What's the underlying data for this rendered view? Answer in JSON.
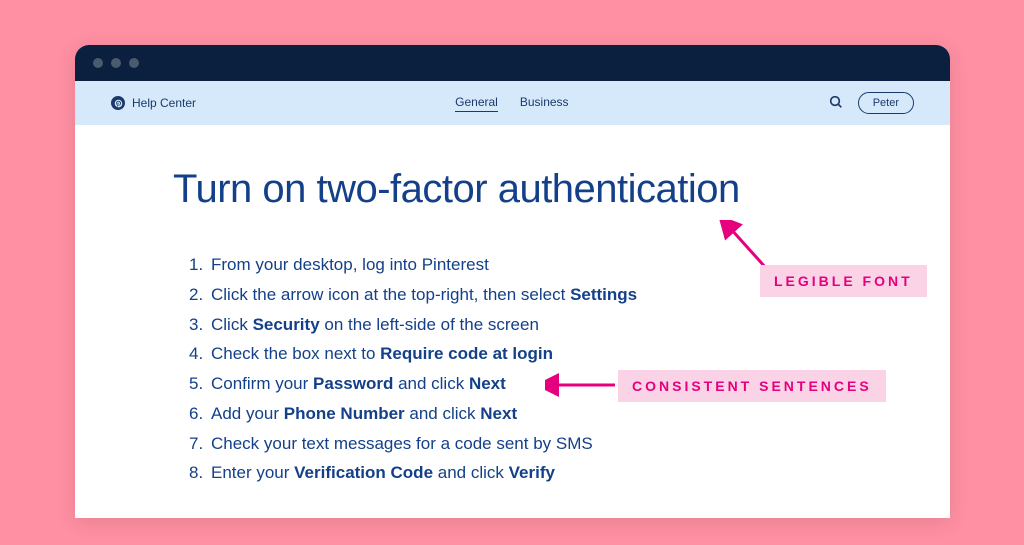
{
  "brand": {
    "help_center_label": "Help Center"
  },
  "nav": {
    "tab_general": "General",
    "tab_business": "Business",
    "user_name": "Peter"
  },
  "page": {
    "title": "Turn on two-factor authentication"
  },
  "steps": [
    {
      "pre": "From your desktop, log into Pinterest",
      "bold1": "",
      "mid": "",
      "bold2": "",
      "post": ""
    },
    {
      "pre": "Click the arrow icon at the top-right, then select ",
      "bold1": "Settings",
      "mid": "",
      "bold2": "",
      "post": ""
    },
    {
      "pre": "Click ",
      "bold1": "Security",
      "mid": " on the left-side of the screen",
      "bold2": "",
      "post": ""
    },
    {
      "pre": "Check the box next to ",
      "bold1": "Require code at login",
      "mid": "",
      "bold2": "",
      "post": ""
    },
    {
      "pre": "Confirm your ",
      "bold1": "Password",
      "mid": " and click ",
      "bold2": "Next",
      "post": ""
    },
    {
      "pre": "Add your ",
      "bold1": "Phone Number",
      "mid": " and click ",
      "bold2": "Next",
      "post": ""
    },
    {
      "pre": "Check your text messages for a code sent by SMS",
      "bold1": "",
      "mid": "",
      "bold2": "",
      "post": ""
    },
    {
      "pre": "Enter your ",
      "bold1": "Verification Code",
      "mid": " and click ",
      "bold2": "Verify",
      "post": ""
    }
  ],
  "annotations": {
    "legible_font": "LEGIBLE FONT",
    "consistent_sentences": "CONSISTENT SENTENCES"
  },
  "colors": {
    "background_pink": "#ff8fa3",
    "titlebar_navy": "#0b1f3f",
    "navbar_blue": "#d6e9fb",
    "text_navy": "#134089",
    "annotation_bg": "#fbd3e6",
    "annotation_text": "#e6007e"
  }
}
